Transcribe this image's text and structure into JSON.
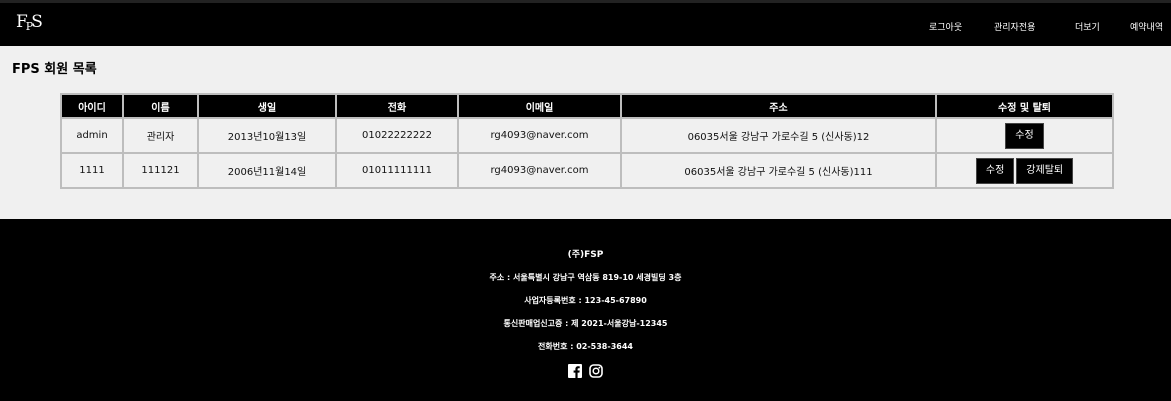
{
  "header": {
    "logo": {
      "main": "F",
      "sub": "P",
      "tail": "S"
    },
    "nav": [
      "로그아웃",
      "관리자전용",
      "더보기",
      "예약내역"
    ]
  },
  "main": {
    "title": "FPS 회원 목록",
    "table": {
      "headers": [
        "아이디",
        "이름",
        "생일",
        "전화",
        "이메일",
        "주소",
        "수정 및 탈퇴"
      ],
      "rows": [
        {
          "id": "admin",
          "name": "관리자",
          "birth": "2013년10월13일",
          "phone": "01022222222",
          "email": "rg4093@naver.com",
          "address": "06035서울 강남구 가로수길 5 (신사동)12",
          "edit": "수정"
        },
        {
          "id": "1111",
          "name": "111121",
          "birth": "2006년11월14일",
          "phone": "01011111111",
          "email": "rg4093@naver.com",
          "address": "06035서울 강남구 가로수길 5 (신사동)111",
          "edit": "수정",
          "delete": "강제탈퇴"
        }
      ]
    }
  },
  "footer": {
    "company": "(주)FSP",
    "address": "주소 : 서울특별시 강남구 역삼동 819-10 세경빌딩 3층",
    "biz_no": "사업자등록번호 : 123-45-67890",
    "mail_order": "통신판매업신고증 : 제 2021-서울강남-12345",
    "phone": "전화번호 : 02-538-3644",
    "social": [
      "facebook-icon",
      "instagram-icon"
    ]
  }
}
